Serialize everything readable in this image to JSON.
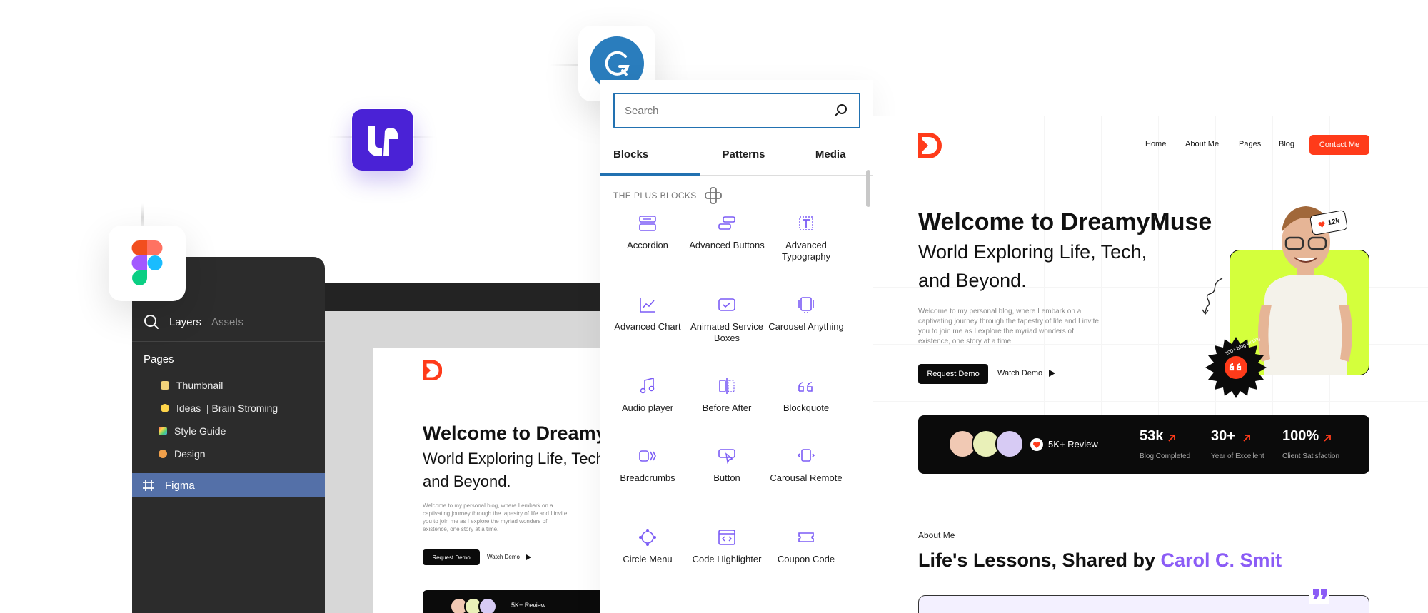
{
  "colors": {
    "figma_bg": "#2c2c2c",
    "figma_selection": "#5470a8",
    "wp_blue": "#2271b1",
    "block_icon": "#7b5cf5",
    "brand_red": "#ff3b1a",
    "accent_purple": "#8b5cf6",
    "lime": "#d4ff3c",
    "uichemy_purple": "#4a22d6",
    "grammarly_blue": "#2a7dbd"
  },
  "icons": {
    "uichemy": "uichemy-logo-icon",
    "grammarly": "grammarly-logo-icon",
    "figma": "figma-logo-icon"
  },
  "figma": {
    "tabs": {
      "layers": "Layers",
      "assets": "Assets"
    },
    "pages_label": "Pages",
    "pages": [
      {
        "label": "Thumbnail",
        "emoji_color": "#f1d27a"
      },
      {
        "label": "Ideas  | Brain Stroming",
        "emoji_color": "#ffd54a"
      },
      {
        "label": "Style Guide",
        "emoji_color": "#ff8a3d"
      },
      {
        "label": "Design",
        "emoji_color": "#f0a04b"
      }
    ],
    "selected_frame": "Figma"
  },
  "mini_site": {
    "title": "Welcome to DreamyMuse",
    "subtitle_1": "World Exploring Life, Tech,",
    "subtitle_2": "and Beyond.",
    "paragraph": "Welcome to my personal blog, where I embark on a captivating journey through the tapestry of life and I invite you to join me as I explore the myriad wonders of existence, one story at a time.",
    "request_demo": "Request Demo",
    "watch_demo": "Watch Demo",
    "review": "5K+ Review"
  },
  "inserter": {
    "search_placeholder": "Search",
    "tabs": [
      "Blocks",
      "Patterns",
      "Media"
    ],
    "section_label": "THE PLUS BLOCKS",
    "blocks": [
      {
        "label": "Accordion",
        "icon": "accordion-icon"
      },
      {
        "label": "Advanced Buttons",
        "icon": "advanced-buttons-icon"
      },
      {
        "label": "Advanced Typography",
        "icon": "advanced-typography-icon"
      },
      {
        "label": "Advanced Chart",
        "icon": "advanced-chart-icon"
      },
      {
        "label": "Animated Service Boxes",
        "icon": "animated-service-boxes-icon"
      },
      {
        "label": "Carousel Anything",
        "icon": "carousel-anything-icon"
      },
      {
        "label": "Audio player",
        "icon": "audio-player-icon"
      },
      {
        "label": "Before After",
        "icon": "before-after-icon"
      },
      {
        "label": "Blockquote",
        "icon": "blockquote-icon"
      },
      {
        "label": "Breadcrumbs",
        "icon": "breadcrumbs-icon"
      },
      {
        "label": "Button",
        "icon": "button-icon"
      },
      {
        "label": "Carousal Remote",
        "icon": "carousal-remote-icon"
      },
      {
        "label": "Circle Menu",
        "icon": "circle-menu-icon"
      },
      {
        "label": "Code Highlighter",
        "icon": "code-highlighter-icon"
      },
      {
        "label": "Coupon Code",
        "icon": "coupon-code-icon"
      }
    ]
  },
  "site": {
    "nav": [
      "Home",
      "About Me",
      "Pages",
      "Blog"
    ],
    "contact_label": "Contact Me",
    "title": "Welcome to DreamyMuse",
    "subtitle_1": "World Exploring Life, Tech,",
    "subtitle_2": "and Beyond.",
    "paragraph": "Welcome to my personal blog, where I embark on a captivating journey through the tapestry of life and I invite you to join me as I explore the myriad wonders of existence, one story at a time.",
    "request_demo": "Request Demo",
    "watch_demo": "Watch Demo",
    "badge_count": "12k",
    "badge_ring": "100+ blog writing",
    "review": "5K+ Review",
    "stats": [
      {
        "num": "53k",
        "label": "Blog Completed"
      },
      {
        "num": "30+",
        "label": "Year of Excellent"
      },
      {
        "num": "100%",
        "label": "Client Satisfaction"
      }
    ],
    "about_label": "About Me",
    "about_title": "Life's Lessons, Shared by ",
    "about_name": "Carol C. Smit"
  }
}
